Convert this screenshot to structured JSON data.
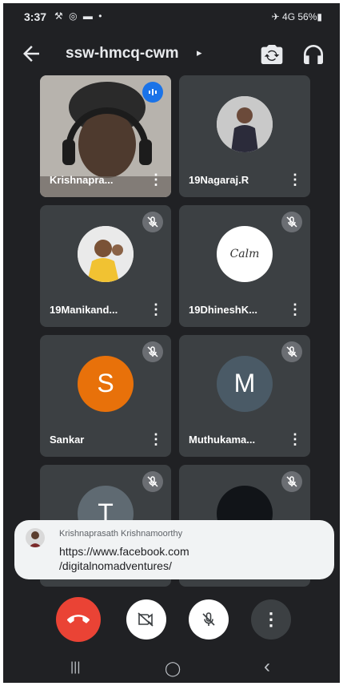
{
  "status_bar": {
    "time": "3:37",
    "left_icons": "⚒ ◎ ▬ •",
    "right_text": "✈ 4G 56%▮"
  },
  "header": {
    "meeting_code": "ssw-hmcq-cwm",
    "caret": "▸",
    "back_icon": "back-arrow-icon",
    "switch_camera_icon": "switch-camera-icon",
    "audio_icon": "headphones-icon"
  },
  "participants": [
    {
      "name": "Krishnapra...",
      "state": "speaking"
    },
    {
      "name": "19Nagaraj.R",
      "state": ""
    },
    {
      "name": "19Manikand...",
      "state": "muted"
    },
    {
      "name": "19DhineshK...",
      "state": "muted",
      "avatar_text": "Calm"
    },
    {
      "name": "Sankar",
      "state": "muted",
      "initial": "S",
      "color": "#e8710a"
    },
    {
      "name": "Muthukama...",
      "state": "muted",
      "initial": "M",
      "color": "#4a5a66"
    },
    {
      "name": "",
      "state": "muted",
      "initial": "T",
      "color": "#5f6a72"
    },
    {
      "name": "",
      "state": "muted"
    }
  ],
  "toast": {
    "sender": "Krishnaprasath Krishnamoorthy",
    "message_line1": "https://www.facebook.com",
    "message_line2": "/digitalnomadventures/"
  },
  "controls": {
    "end_call_color": "#ea4335",
    "more_label": "⋮"
  },
  "nav_bar": {
    "recent": "|||",
    "home": "◯",
    "back": "‹"
  }
}
